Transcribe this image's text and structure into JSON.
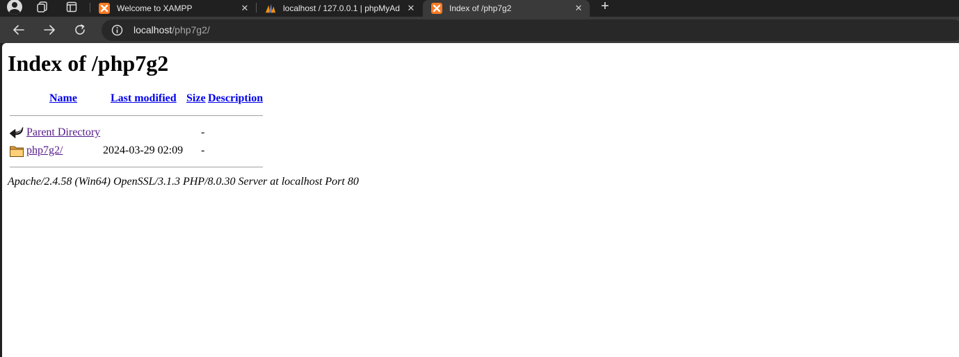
{
  "browser": {
    "tabs": [
      {
        "title": "Welcome to XAMPP",
        "favicon": "xampp-icon",
        "active": false
      },
      {
        "title": "localhost / 127.0.0.1 | phpMyAdmin",
        "favicon": "phpmyadmin-icon",
        "active": false
      },
      {
        "title": "Index of /php7g2",
        "favicon": "xampp-icon",
        "active": true
      }
    ],
    "close_glyph": "✕",
    "new_tab_glyph": "+",
    "address": {
      "host": "localhost",
      "path": "/php7g2/"
    }
  },
  "page": {
    "heading": "Index of /php7g2",
    "columns": {
      "name": "Name",
      "last_modified": "Last modified",
      "size": "Size",
      "description": "Description"
    },
    "rows": [
      {
        "icon": "back-arrow-icon",
        "name": "Parent Directory",
        "last_modified": "",
        "size": "-",
        "description": ""
      },
      {
        "icon": "folder-icon",
        "name": "php7g2/",
        "last_modified": "2024-03-29 02:09",
        "size": "-",
        "description": ""
      }
    ],
    "footer": "Apache/2.4.58 (Win64) OpenSSL/3.1.3 PHP/8.0.30 Server at localhost Port 80"
  },
  "colors": {
    "link": "#0000ee",
    "visited_link": "#551a8b",
    "xampp_orange": "#fb7a24",
    "chrome_dark": "#202020",
    "toolbar": "#3a3a3a"
  }
}
